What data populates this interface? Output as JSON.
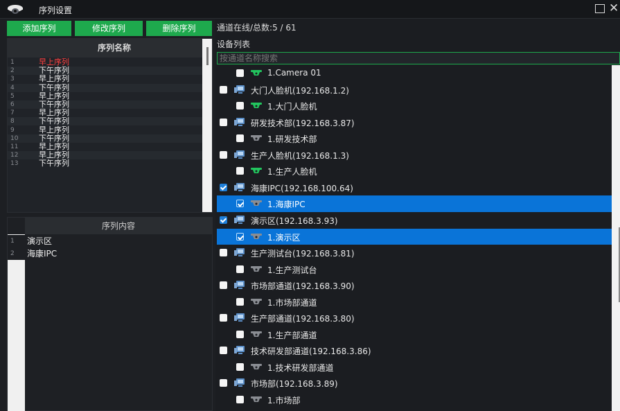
{
  "titlebar": {
    "title": "序列设置"
  },
  "toolbar": {
    "add_label": "添加序列",
    "modify_label": "修改序列",
    "delete_label": "删除序列"
  },
  "sequence_grid": {
    "header": "序列名称",
    "rows": [
      {
        "num": "1",
        "name": "早上序列",
        "active": true
      },
      {
        "num": "2",
        "name": "下午序列"
      },
      {
        "num": "3",
        "name": "早上序列"
      },
      {
        "num": "4",
        "name": "下午序列"
      },
      {
        "num": "5",
        "name": "早上序列"
      },
      {
        "num": "6",
        "name": "下午序列"
      },
      {
        "num": "7",
        "name": "早上序列"
      },
      {
        "num": "8",
        "name": "下午序列"
      },
      {
        "num": "9",
        "name": "早上序列"
      },
      {
        "num": "10",
        "name": "下午序列"
      },
      {
        "num": "11",
        "name": "早上序列"
      },
      {
        "num": "12",
        "name": "早上序列"
      },
      {
        "num": "13",
        "name": "下午序列"
      }
    ]
  },
  "content_grid": {
    "header": "序列内容",
    "rows": [
      {
        "num": "1",
        "name": "演示区"
      },
      {
        "num": "2",
        "name": "海康IPC"
      }
    ]
  },
  "status": {
    "text": "通道在线/总数:5 / 61"
  },
  "device_list": {
    "label": "设备列表",
    "search_placeholder": "按通道名称搜索",
    "nodes": [
      {
        "level": 1,
        "label": "1.Camera 01",
        "checked": false,
        "icon": "camera-online",
        "selected": false
      },
      {
        "level": 0,
        "label": "大门人脸机(192.168.1.2)",
        "checked": false,
        "icon": "device",
        "selected": false
      },
      {
        "level": 1,
        "label": "1.大门人脸机",
        "checked": false,
        "icon": "camera-online",
        "selected": false
      },
      {
        "level": 0,
        "label": "研发技术部(192.168.3.87)",
        "checked": false,
        "icon": "device",
        "selected": false
      },
      {
        "level": 1,
        "label": "1.研发技术部",
        "checked": false,
        "icon": "camera-offline",
        "selected": false
      },
      {
        "level": 0,
        "label": "生产人脸机(192.168.1.3)",
        "checked": false,
        "icon": "device",
        "selected": false
      },
      {
        "level": 1,
        "label": "1.生产人脸机",
        "checked": false,
        "icon": "camera-online",
        "selected": false
      },
      {
        "level": 0,
        "label": "海康IPC(192.168.100.64)",
        "checked": true,
        "icon": "device",
        "selected": false
      },
      {
        "level": 1,
        "label": "1.海康IPC",
        "checked": true,
        "icon": "camera-offline",
        "selected": true
      },
      {
        "level": 0,
        "label": "演示区(192.168.3.93)",
        "checked": true,
        "icon": "device",
        "selected": false
      },
      {
        "level": 1,
        "label": "1.演示区",
        "checked": true,
        "icon": "camera-offline",
        "selected": true
      },
      {
        "level": 0,
        "label": "生产测试台(192.168.3.81)",
        "checked": false,
        "icon": "device",
        "selected": false
      },
      {
        "level": 1,
        "label": "1.生产测试台",
        "checked": false,
        "icon": "camera-offline",
        "selected": false
      },
      {
        "level": 0,
        "label": "市场部通道(192.168.3.90)",
        "checked": false,
        "icon": "device",
        "selected": false
      },
      {
        "level": 1,
        "label": "1.市场部通道",
        "checked": false,
        "icon": "camera-offline",
        "selected": false
      },
      {
        "level": 0,
        "label": "生产部通道(192.168.3.80)",
        "checked": false,
        "icon": "device",
        "selected": false
      },
      {
        "level": 1,
        "label": "1.生产部通道",
        "checked": false,
        "icon": "camera-offline",
        "selected": false
      },
      {
        "level": 0,
        "label": "技术研发部通道(192.168.3.86)",
        "checked": false,
        "icon": "device",
        "selected": false
      },
      {
        "level": 1,
        "label": "1.技术研发部通道",
        "checked": false,
        "icon": "camera-offline",
        "selected": false
      },
      {
        "level": 0,
        "label": "市场部(192.168.3.89)",
        "checked": false,
        "icon": "device",
        "selected": false
      },
      {
        "level": 1,
        "label": "1.市场部",
        "checked": false,
        "icon": "camera-offline",
        "selected": false
      }
    ]
  },
  "colors": {
    "accent_green": "#1ea94d",
    "selection_blue": "#0a74d8",
    "active_red": "#ff4040",
    "online_green": "#22c55e",
    "offline_gray": "#8a8d93"
  }
}
